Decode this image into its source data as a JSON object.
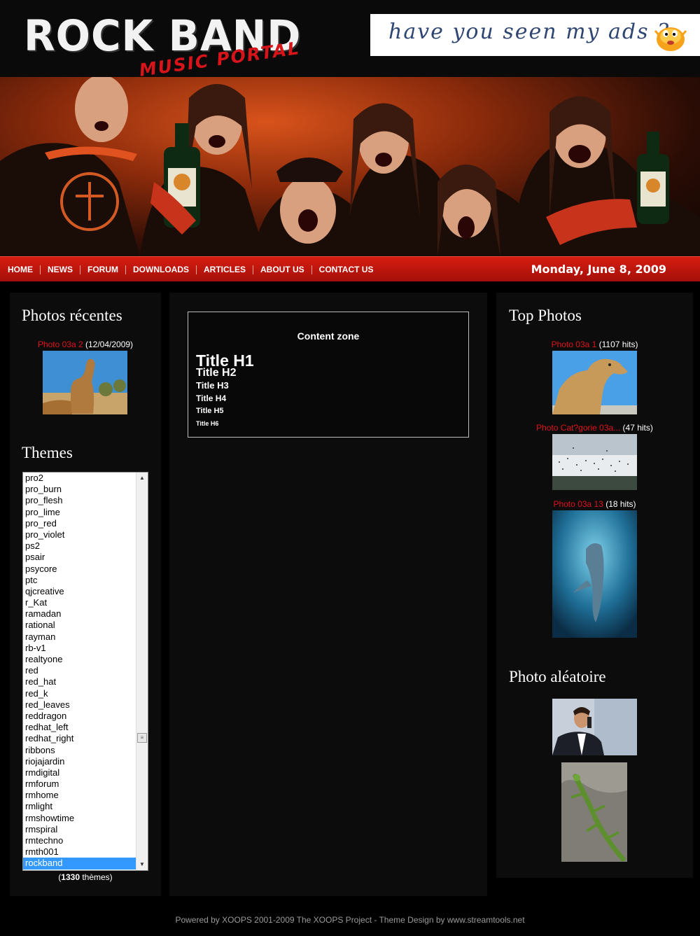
{
  "header": {
    "logo_main": "ROCK BAND",
    "logo_sub": "MUSIC PORTAL",
    "ad_text": "have you seen my ads ?"
  },
  "nav": {
    "items": [
      "HOME",
      "NEWS",
      "FORUM",
      "DOWNLOADS",
      "ARTICLES",
      "ABOUT US",
      "CONTACT US"
    ],
    "date": "Monday, June 8, 2009"
  },
  "left": {
    "recent_title": "Photos récentes",
    "recent_photo": {
      "name": "Photo 03a 2",
      "meta": " (12/04/2009)"
    },
    "themes_title": "Themes",
    "themes": [
      "pro2",
      "pro_burn",
      "pro_flesh",
      "pro_lime",
      "pro_red",
      "pro_violet",
      "ps2",
      "psair",
      "psycore",
      "ptc",
      "qjcreative",
      "r_Kat",
      "ramadan",
      "rational",
      "rayman",
      "rb-v1",
      "realtyone",
      "red",
      "red_hat",
      "red_k",
      "red_leaves",
      "reddragon",
      "redhat_left",
      "redhat_right",
      "ribbons",
      "riojajardin",
      "rmdigital",
      "rmforum",
      "rmhome",
      "rmlight",
      "rmshowtime",
      "rmspiral",
      "rmtechno",
      "rmth001",
      "rockband"
    ],
    "themes_selected": "rockband",
    "themes_count_open": "(",
    "themes_count": "1330",
    "themes_count_label": " thèmes)"
  },
  "center": {
    "zone_title": "Content zone",
    "h1": "Title H1",
    "h2": "Title H2",
    "h3": "Title H3",
    "h4": "Title H4",
    "h5": "Title H5",
    "h6": "Title H6"
  },
  "right": {
    "top_title": "Top Photos",
    "top_photos": [
      {
        "name": "Photo 03a 1",
        "meta": " (1107 hits)"
      },
      {
        "name": "Photo Cat?gorie 03a...",
        "meta": " (47 hits)"
      },
      {
        "name": "Photo 03a 13",
        "meta": " (18 hits)"
      }
    ],
    "random_title": "Photo aléatoire"
  },
  "footer": {
    "text": "Powered by XOOPS 2001-2009 The XOOPS Project - Theme Design by www.streamtools.net"
  },
  "colors": {
    "accent_red": "#d61d12",
    "link_red": "#e0121a",
    "ad_text_blue": "#2f4673",
    "select_blue": "#3399ff"
  }
}
